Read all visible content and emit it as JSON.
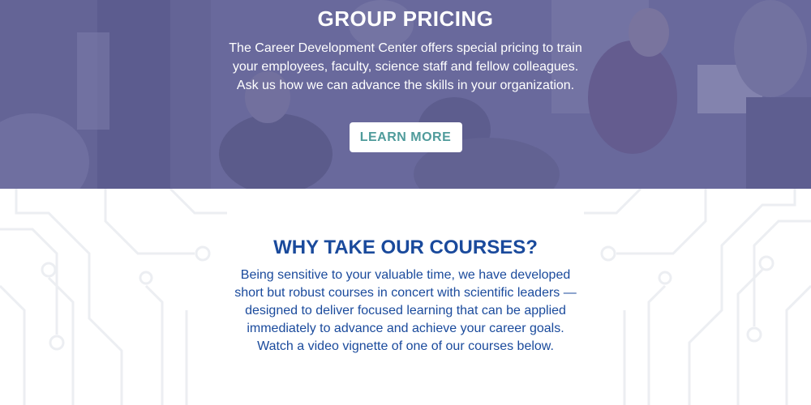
{
  "hero": {
    "title": "GROUP PRICING",
    "description_lines": [
      "The Career Development Center offers special pricing to train",
      "your employees, faculty, science staff and fellow colleagues.",
      "Ask us how we can advance the skills in your organization."
    ],
    "button_label": "LEARN MORE",
    "overlay_color": "#5e5e96"
  },
  "courses": {
    "title": "WHY TAKE OUR COURSES?",
    "description_lines": [
      "Being sensitive to your valuable time, we have developed",
      "short but robust courses in concert with scientific leaders —",
      "designed to deliver focused learning that can be applied",
      "immediately to advance and achieve your career goals.",
      "Watch a video vignette of one of our courses below."
    ],
    "text_color": "#1a4a9c"
  },
  "colors": {
    "button_text": "#4f9b9b",
    "circuit_lines": "#eceef2"
  }
}
